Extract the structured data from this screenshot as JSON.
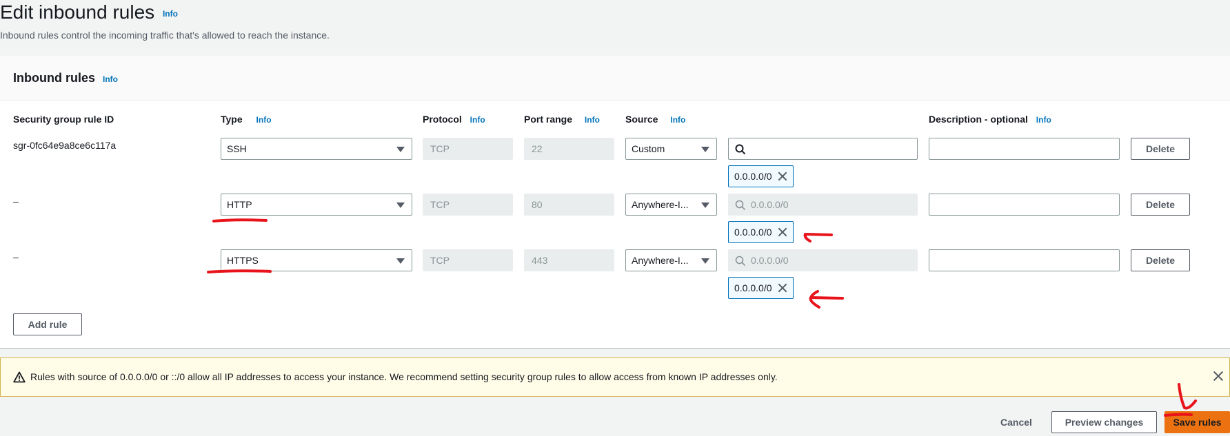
{
  "header": {
    "title": "Edit inbound rules",
    "info": "Info",
    "description": "Inbound rules control the incoming traffic that's allowed to reach the instance."
  },
  "panel": {
    "title": "Inbound rules",
    "info": "Info"
  },
  "columns": {
    "rule_id": "Security group rule ID",
    "type": "Type",
    "protocol": "Protocol",
    "port_range": "Port range",
    "source": "Source",
    "description": "Description - optional",
    "info": "Info"
  },
  "rules": [
    {
      "rule_id": "sgr-0fc64e9a8ce6c117a",
      "type": "SSH",
      "protocol": "TCP",
      "port": "22",
      "source": "Custom",
      "search_placeholder": "",
      "token": "0.0.0.0/0",
      "delete": "Delete"
    },
    {
      "rule_id": "–",
      "type": "HTTP",
      "protocol": "TCP",
      "port": "80",
      "source": "Anywhere-I...",
      "search_placeholder": "0.0.0.0/0",
      "token": "0.0.0.0/0",
      "delete": "Delete"
    },
    {
      "rule_id": "–",
      "type": "HTTPS",
      "protocol": "TCP",
      "port": "443",
      "source": "Anywhere-I...",
      "search_placeholder": "0.0.0.0/0",
      "token": "0.0.0.0/0",
      "delete": "Delete"
    }
  ],
  "add_rule": "Add rule",
  "alert": {
    "text": "Rules with source of 0.0.0.0/0 or ::/0 allow all IP addresses to access your instance. We recommend setting security group rules to allow access from known IP addresses only."
  },
  "footer": {
    "cancel": "Cancel",
    "preview": "Preview changes",
    "save": "Save rules"
  },
  "colors": {
    "primary": "#ec7211",
    "link": "#0073bb",
    "annotation": "#e8131b"
  }
}
